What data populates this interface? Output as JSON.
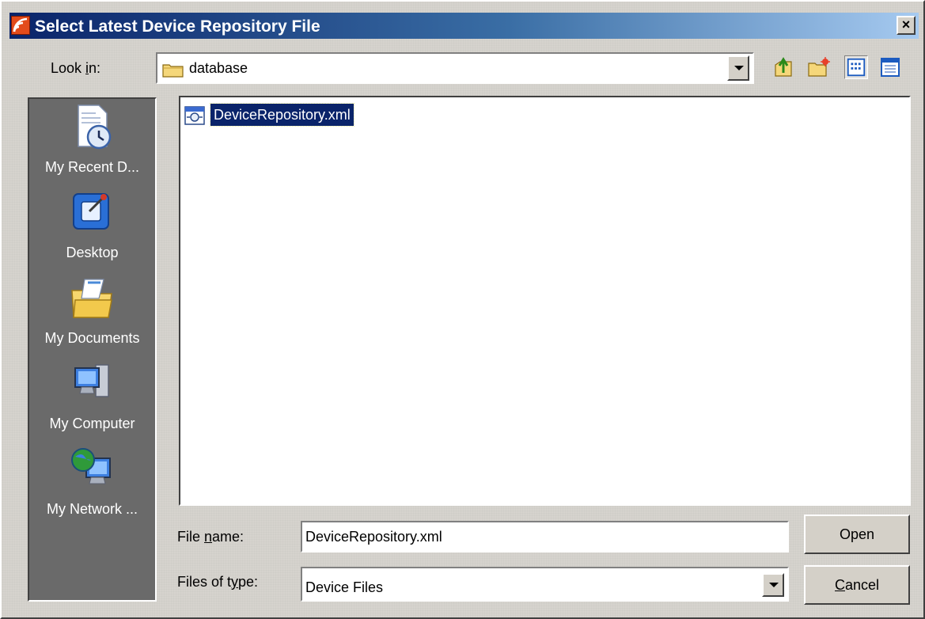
{
  "window": {
    "title": "Select Latest Device Repository File",
    "close_glyph": "×"
  },
  "toolbar": {
    "look_in_label_pre": "Look ",
    "look_in_label_key": "i",
    "look_in_label_post": "n:",
    "look_in_value": "database",
    "icons": [
      "folder-icon",
      "up-one-level-icon",
      "new-folder-icon",
      "list-view-icon",
      "details-view-icon"
    ]
  },
  "places": [
    {
      "label": "My Recent D...",
      "icon": "recent-documents-icon"
    },
    {
      "label": "Desktop",
      "icon": "desktop-icon"
    },
    {
      "label": "My Documents",
      "icon": "my-documents-icon"
    },
    {
      "label": "My Computer",
      "icon": "my-computer-icon"
    },
    {
      "label": "My Network ...",
      "icon": "network-icon"
    }
  ],
  "files": [
    {
      "name": "DeviceRepository.xml",
      "icon": "xml-file-icon",
      "selected": true
    }
  ],
  "form": {
    "file_name_label_pre": "File ",
    "file_name_label_key": "n",
    "file_name_label_post": "ame:",
    "file_name_value": "DeviceRepository.xml",
    "file_type_label_pre": "Files of t",
    "file_type_label_key": "y",
    "file_type_label_post": "pe:",
    "file_type_value": "Device Files",
    "open_label": "Open",
    "cancel_label_key": "C",
    "cancel_label_post": "ancel"
  },
  "colors": {
    "title_gradient_start": "#0a246a",
    "selection": "#0a246a",
    "places_bg": "#6a6a6a"
  }
}
